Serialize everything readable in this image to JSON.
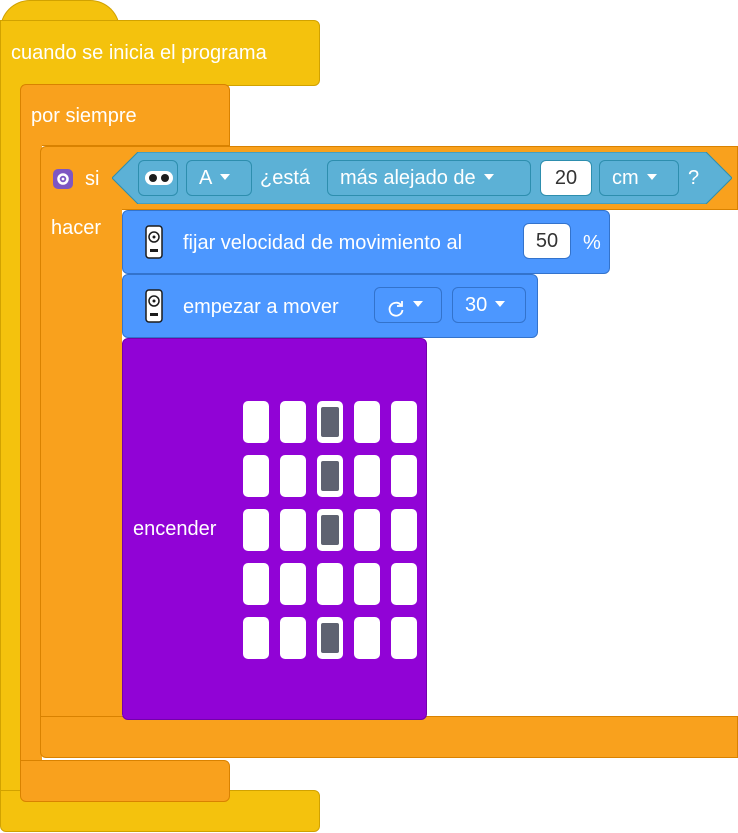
{
  "event": {
    "label": "cuando se inicia el programa"
  },
  "forever": {
    "label": "por siempre"
  },
  "if_block": {
    "si_label": "si",
    "hacer_label": "hacer",
    "gear_icon": "gear-icon",
    "condition": {
      "sensor_icon": "ultrasonic-sensor-icon",
      "port": "A",
      "esta_label": "¿está",
      "comparison": "más alejado de",
      "distance": "20",
      "unit": "cm",
      "question": "?"
    }
  },
  "set_speed": {
    "icon": "motor-pair-icon",
    "label": "fijar velocidad de movimiento al",
    "value": "50",
    "unit": "%"
  },
  "start_move": {
    "icon": "motor-pair-icon",
    "label": "empezar a mover",
    "direction_icon": "rotate-clockwise-icon",
    "steering": "30"
  },
  "display": {
    "label": "encender",
    "grid": [
      [
        0,
        0,
        1,
        0,
        0
      ],
      [
        0,
        0,
        1,
        0,
        0
      ],
      [
        0,
        0,
        1,
        0,
        0
      ],
      [
        0,
        0,
        0,
        0,
        0
      ],
      [
        0,
        0,
        1,
        0,
        0
      ]
    ]
  },
  "colors": {
    "events": "#f4c20d",
    "control": "#f9a11d",
    "sensors": "#5cb1d6",
    "motors": "#4c97ff",
    "light": "#9103d6"
  }
}
